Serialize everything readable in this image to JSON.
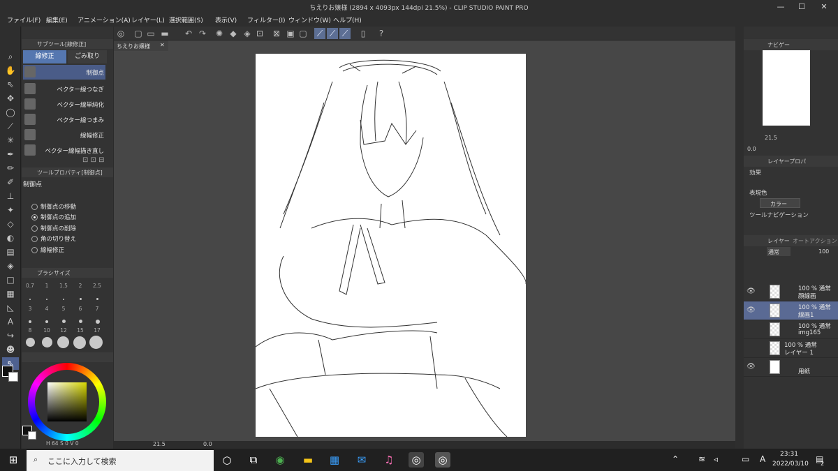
{
  "window": {
    "title": "ちえりお嬢様 (2894 x 4093px 144dpi 21.5%) - CLIP STUDIO PAINT PRO",
    "min": "—",
    "max": "☐",
    "close": "✕"
  },
  "menu": [
    "ファイル(F)",
    "編集(E)",
    "アニメーション(A)",
    "レイヤー(L)",
    "選択範囲(S)",
    "表示(V)",
    "フィルター(I)",
    "ウィンドウ(W)",
    "ヘルプ(H)"
  ],
  "document_tab": {
    "label": "ちえりお嬢様",
    "close": "✕"
  },
  "subtool_panel": {
    "header": "サブツール[線修正]",
    "tabs": [
      "線修正",
      "ごみ取り"
    ],
    "items": [
      "制御点",
      "ベクター線つなぎ",
      "ベクター線単純化",
      "ベクター線つまみ",
      "線幅修正",
      "ベクター線幅描き直し"
    ]
  },
  "tool_property": {
    "header": "ツールプロパティ[制御点]",
    "title": "制御点",
    "options": [
      {
        "label": "制御点の移動",
        "on": false
      },
      {
        "label": "制御点の追加",
        "on": true
      },
      {
        "label": "制御点の削除",
        "on": false
      },
      {
        "label": "角の切り替え",
        "on": false
      },
      {
        "label": "線幅修正",
        "on": false
      }
    ]
  },
  "brush_size": {
    "header": "ブラシサイズ",
    "rows": [
      [
        "0.7",
        "1",
        "1.5",
        "2",
        "2.5"
      ],
      [
        "3",
        "4",
        "5",
        "6",
        "7"
      ],
      [
        "8",
        "10",
        "12",
        "15",
        "17"
      ]
    ]
  },
  "color": {
    "fg": "#111111",
    "bg": "#ffffff",
    "ring_center": "#b9b94a",
    "readout_a": "64",
    "readout_s": "S",
    "readout_0": "0",
    "readout_v": "V",
    "readout_0b": "0"
  },
  "statusbar": {
    "zoom": "21.5",
    "angle": "0.0"
  },
  "navigator": {
    "tab": "ナビゲー",
    "zoom": "21.5",
    "angle": "0.0"
  },
  "layer_property": {
    "tab": "レイヤープロパ",
    "effect_label": "効果",
    "color_label": "表現色",
    "color_value": "カラー",
    "tool_nav_label": "ツールナビゲーション"
  },
  "layer_panel": {
    "tab": "レイヤー",
    "tab2": "オートアクション",
    "blend": "通常",
    "opacity": "100",
    "layers": [
      {
        "line1": "100 % 通常",
        "line2": "顔線画",
        "visible": true,
        "selected": false
      },
      {
        "line1": "100 % 通常",
        "line2": "線画1",
        "visible": true,
        "selected": true
      },
      {
        "line1": "100 % 通常",
        "line2": "img165",
        "visible": false,
        "selected": false
      },
      {
        "line1": "100 % 通常",
        "line2": "レイヤー 1",
        "visible": false,
        "selected": false
      },
      {
        "line1": "",
        "line2": "用紙",
        "visible": true,
        "selected": false
      }
    ]
  },
  "taskbar": {
    "search_placeholder": "ここに入力して検索",
    "time": "23:31",
    "date": "2022/03/10",
    "ime": "A",
    "notif": "2"
  }
}
